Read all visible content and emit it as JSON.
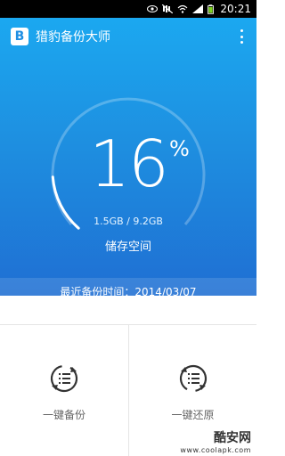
{
  "status_bar": {
    "time": "20:21",
    "icons": [
      "eye-icon",
      "mute-icon",
      "wifi-icon",
      "signal-icon",
      "battery-icon"
    ]
  },
  "app": {
    "title": "猎豹备份大师",
    "logo_letter": "B"
  },
  "gauge": {
    "percent": "16",
    "percent_sign": "%",
    "capacity": "1.5GB / 9.2GB",
    "label": "储存空间",
    "fill_fraction": 0.16
  },
  "last_backup": {
    "text": "最近备份时间：2014/03/07"
  },
  "actions": [
    {
      "label": "一键备份",
      "icon": "backup-icon"
    },
    {
      "label": "一键还原",
      "icon": "restore-icon"
    }
  ],
  "watermark": {
    "name": "酷安网",
    "url": "www.coolapk.com"
  },
  "colors": {
    "accent": "#1f8fe3",
    "hero_top": "#1ba8f0",
    "hero_bottom": "#1f6fd3"
  }
}
